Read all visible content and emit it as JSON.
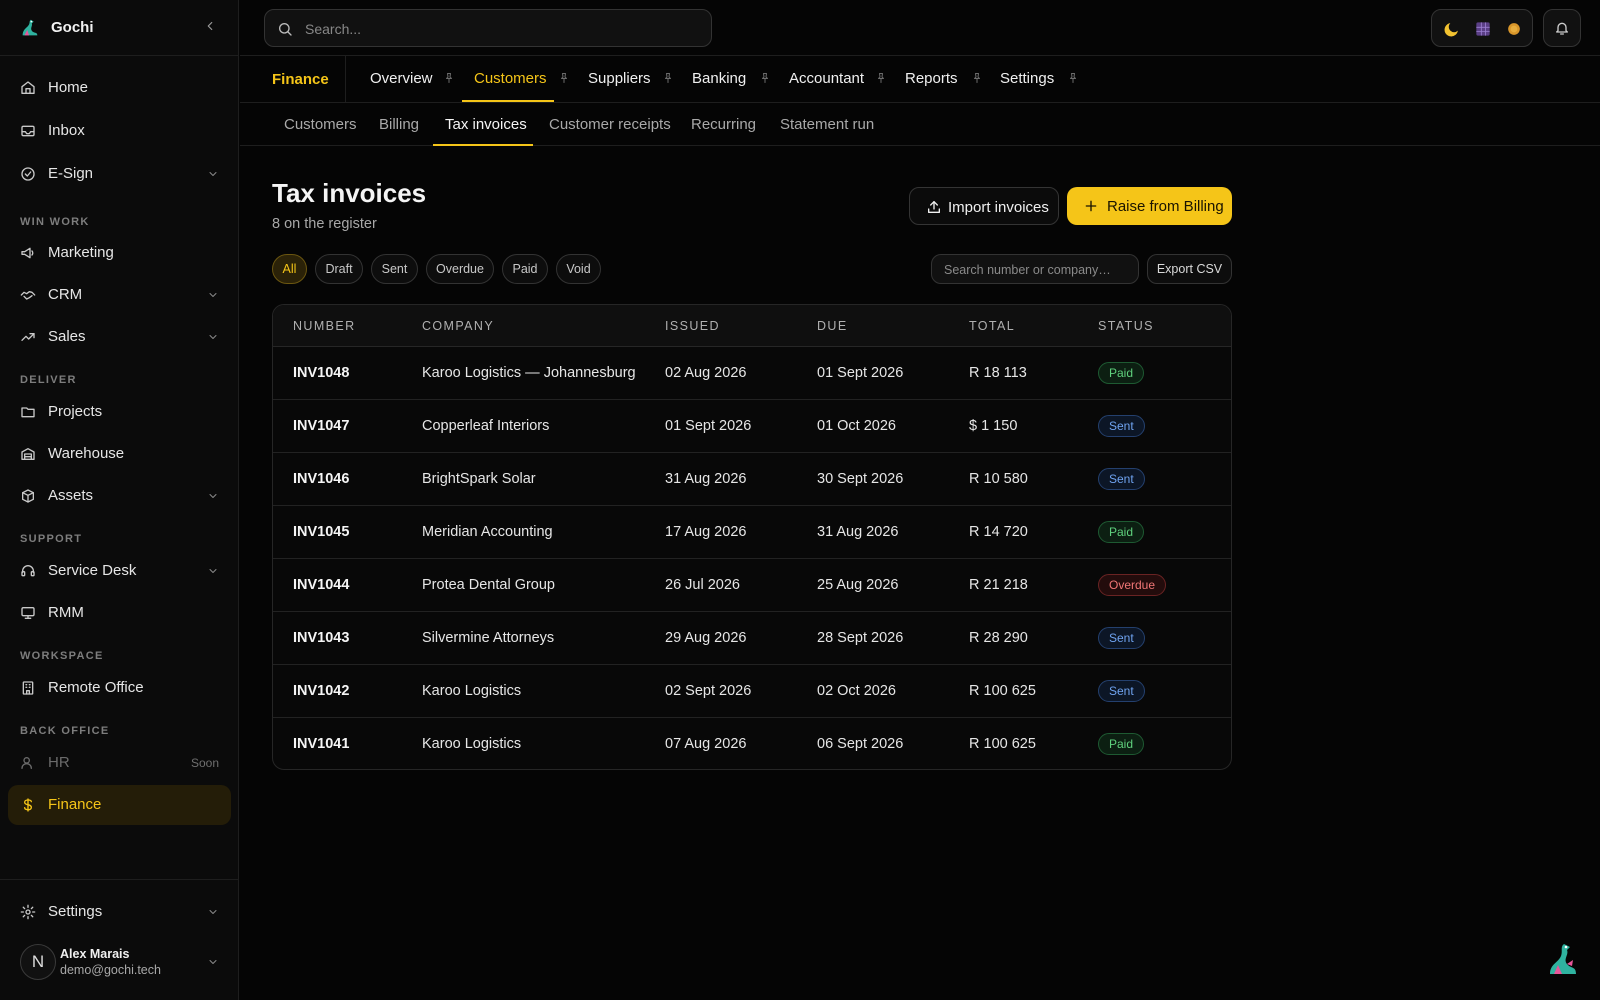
{
  "app": {
    "name": "Gochi"
  },
  "sidebar": {
    "items": [
      {
        "label": "Home",
        "icon": "home-icon"
      },
      {
        "label": "Inbox",
        "icon": "inbox-icon"
      },
      {
        "label": "E-Sign",
        "icon": "check-circle-icon"
      },
      {
        "label": "Marketing",
        "icon": "megaphone-icon"
      },
      {
        "label": "CRM",
        "icon": "handshake-icon"
      },
      {
        "label": "Sales",
        "icon": "trending-up-icon"
      },
      {
        "label": "Projects",
        "icon": "folder-icon"
      },
      {
        "label": "Warehouse",
        "icon": "warehouse-icon"
      },
      {
        "label": "Assets",
        "icon": "box-icon"
      },
      {
        "label": "Service Desk",
        "icon": "headset-icon"
      },
      {
        "label": "RMM",
        "icon": "monitor-icon"
      },
      {
        "label": "Remote Office",
        "icon": "building-icon"
      },
      {
        "label": "HR",
        "icon": "user-icon",
        "badge": "Soon"
      },
      {
        "label": "Finance",
        "icon": "dollar-icon"
      }
    ],
    "sections": [
      "WIN WORK",
      "DELIVER",
      "SUPPORT",
      "WORKSPACE",
      "BACK OFFICE"
    ],
    "settings_label": "Settings",
    "user": {
      "initial": "N",
      "name": "Alex Marais",
      "email": "demo@gochi.tech"
    }
  },
  "topbar": {
    "search_placeholder": "Search..."
  },
  "module": {
    "label": "Finance",
    "tabs": [
      "Overview",
      "Customers",
      "Suppliers",
      "Banking",
      "Accountant",
      "Reports",
      "Settings"
    ],
    "active_tab": "Customers"
  },
  "subtabs": {
    "items": [
      "Customers",
      "Billing",
      "Tax invoices",
      "Customer receipts",
      "Recurring",
      "Statement run"
    ],
    "active": "Tax invoices"
  },
  "page": {
    "title": "Tax invoices",
    "subtitle": "8 on the register",
    "import_label": "Import invoices",
    "raise_label": "Raise from Billing"
  },
  "filters": {
    "chips": [
      "All",
      "Draft",
      "Sent",
      "Overdue",
      "Paid",
      "Void"
    ],
    "active": "All",
    "search_placeholder": "Search number or company…",
    "export_label": "Export CSV"
  },
  "table": {
    "columns": [
      "NUMBER",
      "COMPANY",
      "ISSUED",
      "DUE",
      "TOTAL",
      "STATUS"
    ],
    "rows": [
      {
        "number": "INV1048",
        "company": "Karoo Logistics — Johannesburg",
        "issued": "02 Aug 2026",
        "due": "01 Sept 2026",
        "total": "R 18 113",
        "status": "Paid"
      },
      {
        "number": "INV1047",
        "company": "Copperleaf Interiors",
        "issued": "01 Sept 2026",
        "due": "01 Oct 2026",
        "total": "$ 1 150",
        "status": "Sent"
      },
      {
        "number": "INV1046",
        "company": "BrightSpark Solar",
        "issued": "31 Aug 2026",
        "due": "30 Sept 2026",
        "total": "R 10 580",
        "status": "Sent"
      },
      {
        "number": "INV1045",
        "company": "Meridian Accounting",
        "issued": "17 Aug 2026",
        "due": "31 Aug 2026",
        "total": "R 14 720",
        "status": "Paid"
      },
      {
        "number": "INV1044",
        "company": "Protea Dental Group",
        "issued": "26 Jul 2026",
        "due": "25 Aug 2026",
        "total": "R 21 218",
        "status": "Overdue"
      },
      {
        "number": "INV1043",
        "company": "Silvermine Attorneys",
        "issued": "29 Aug 2026",
        "due": "28 Sept 2026",
        "total": "R 28 290",
        "status": "Sent"
      },
      {
        "number": "INV1042",
        "company": "Karoo Logistics",
        "issued": "02 Sept 2026",
        "due": "02 Oct 2026",
        "total": "R 100 625",
        "status": "Sent"
      },
      {
        "number": "INV1041",
        "company": "Karoo Logistics",
        "issued": "07 Aug 2026",
        "due": "06 Sept 2026",
        "total": "R 100 625",
        "status": "Paid"
      }
    ]
  },
  "colors": {
    "accent": "#f5c518",
    "background": "#050505",
    "paid": "#5fd07d",
    "sent": "#6fa3f0",
    "overdue": "#f07676"
  }
}
